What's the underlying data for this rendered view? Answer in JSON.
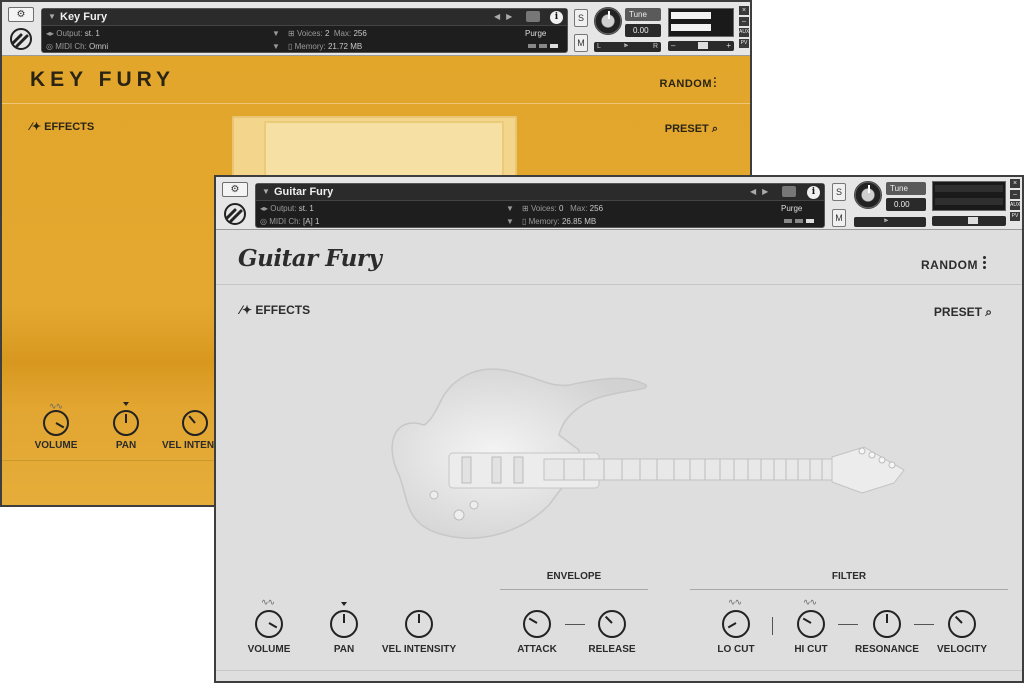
{
  "key_fury": {
    "header": {
      "instrument_name": "Key Fury",
      "output_label": "Output:",
      "output_value": "st. 1",
      "midi_label": "MIDI Ch:",
      "midi_value": "Omni",
      "voices_label": "Voices:",
      "voices_value": "2",
      "max_label": "Max:",
      "max_value": "256",
      "memory_label": "Memory:",
      "memory_value": "21.72 MB",
      "purge_label": "Purge",
      "tune_label": "Tune",
      "tune_value": "0.00",
      "solo_label": "S",
      "mute_label": "M",
      "pan_left": "L",
      "pan_right": "R"
    },
    "title": "KEY FURY",
    "random_label": "RANDOM",
    "effects_label": "EFFECTS",
    "preset_label": "PRESET",
    "knobs": [
      "VOLUME",
      "PAN",
      "VEL INTENSI"
    ]
  },
  "guitar_fury": {
    "header": {
      "instrument_name": "Guitar Fury",
      "output_label": "Output:",
      "output_value": "st. 1",
      "midi_label": "MIDI Ch:",
      "midi_value": "[A]  1",
      "voices_label": "Voices:",
      "voices_value": "0",
      "max_label": "Max:",
      "max_value": "256",
      "memory_label": "Memory:",
      "memory_value": "26.85 MB",
      "purge_label": "Purge",
      "tune_label": "Tune",
      "tune_value": "0.00",
      "solo_label": "S",
      "mute_label": "M"
    },
    "title": "Guitar Fury",
    "random_label": "RANDOM",
    "effects_label": "EFFECTS",
    "preset_label": "PRESET",
    "envelope_label": "ENVELOPE",
    "filter_label": "FILTER",
    "knobs": {
      "volume": "VOLUME",
      "pan": "PAN",
      "vel_intensity": "VEL INTENSITY",
      "attack": "ATTACK",
      "release": "RELEASE",
      "lo_cut": "LO CUT",
      "hi_cut": "HI CUT",
      "resonance": "RESONANCE",
      "velocity": "VELOCITY"
    }
  },
  "window_controls": {
    "close": "×",
    "minimize": "–",
    "aux": "AUX",
    "pv": "PV"
  },
  "colors": {
    "key_fury_bg": "#e2a62b",
    "guitar_fury_bg": "#dedede",
    "header_bg": "#e6e6e6",
    "infobox_bg": "#1e1e1e"
  },
  "icons": [
    "wrench-icon",
    "kontakt-logo-icon",
    "camera-icon",
    "info-icon",
    "wand-icon",
    "search-icon",
    "more-vert-icon",
    "wave-icon"
  ]
}
